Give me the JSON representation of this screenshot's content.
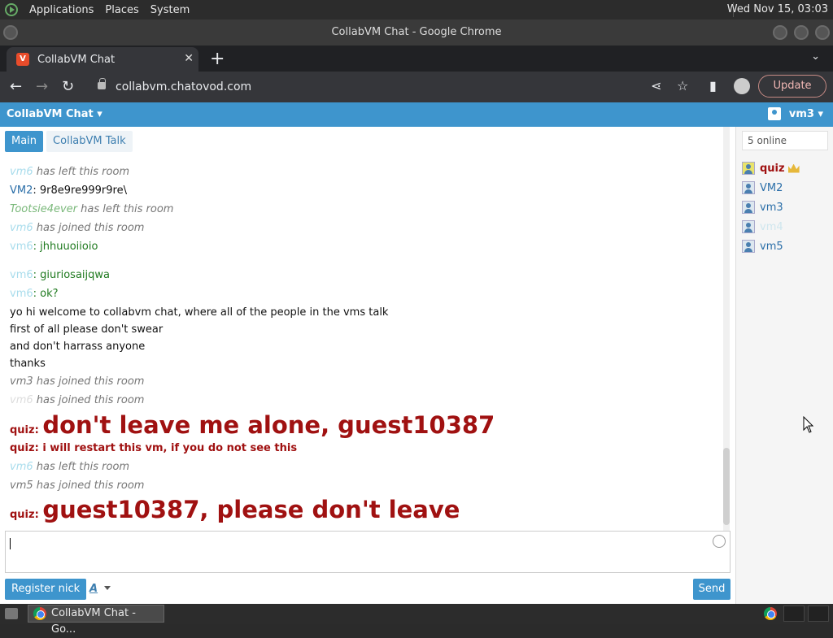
{
  "system_panel": {
    "menus": [
      "Applications",
      "Places",
      "System"
    ],
    "clock": "Wed Nov 15, 03:03"
  },
  "window": {
    "title": "CollabVM Chat - Google Chrome"
  },
  "browser": {
    "tab_title": "CollabVM Chat",
    "url": "collabvm.chatovod.com",
    "update_label": "Update"
  },
  "app": {
    "brand": "CollabVM Chat",
    "current_user": "vm3",
    "rooms": [
      "Main",
      "CollabVM Talk"
    ],
    "online_count": "5 online",
    "users": [
      "quiz",
      "VM2",
      "vm3",
      "vm4",
      "vm5"
    ],
    "messages": {
      "m1_nick": "vm6",
      "m1_text": "has left this room",
      "m2_nick": "VM2",
      "m2_text": ": 9r8e9re999r9re\\",
      "m3_nick": "Tootsie4ever",
      "m3_text": "has left this room",
      "m4_nick": "vm6",
      "m4_text": "has joined this room",
      "m5_nick": "vm6",
      "m5_text": ": jhhuuoiioio",
      "m6_nick": "vm6",
      "m6_text": ": giuriosaijqwa",
      "m7_nick": "vm6",
      "m7_text": ": ok?",
      "m8_text": "yo hi welcome to collabvm chat, where all of the people in the vms talk",
      "m9_text": "first of all please don't swear",
      "m10_text": "and don't harrass anyone",
      "m11_text": "thanks",
      "m12_text": "vm3 has joined this room",
      "m13_nick": "vm6",
      "m13_text": "has joined this room",
      "m14_nick": "quiz",
      "m14_text": "don't leave me alone, guest10387",
      "m15_nick": "quiz",
      "m15_text": "i will restart this vm, if you do not see this",
      "m16_nick": "vm6",
      "m16_text": "has left this room",
      "m17_text": "vm5 has joined this room",
      "m18_nick": "quiz",
      "m18_text": "guest10387, please don't leave"
    },
    "register_label": "Register nick",
    "format_label": "A",
    "send_label": "Send"
  },
  "taskbar": {
    "window_label": "CollabVM Chat - Go..."
  },
  "colors": {
    "accent": "#3e95cd",
    "quiz": "#a01111"
  }
}
